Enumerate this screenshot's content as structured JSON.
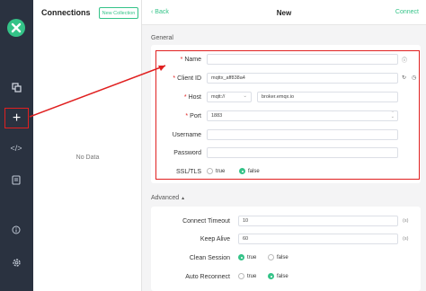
{
  "sidebar": {
    "logo": "mqttx-logo",
    "icons": [
      "connections-icon",
      "add-icon",
      "script-icon",
      "log-icon",
      "info-icon",
      "gear-icon"
    ]
  },
  "connections": {
    "title": "Connections",
    "new_collection": "New Collection",
    "empty": "No Data"
  },
  "header": {
    "back": "Back",
    "title": "New",
    "connect": "Connect"
  },
  "general": {
    "title": "General",
    "name_label": "Name",
    "name_value": "",
    "client_id_label": "Client ID",
    "client_id_value": "mqttx_aff838a4",
    "host_label": "Host",
    "protocol": "mqtt://",
    "host_value": "broker.emqx.io",
    "port_label": "Port",
    "port_value": "1883",
    "username_label": "Username",
    "password_label": "Password",
    "ssl_label": "SSL/TLS",
    "ssl_true": "true",
    "ssl_false": "false",
    "ssl_selected": "false"
  },
  "advanced": {
    "title": "Advanced",
    "connect_timeout_label": "Connect Timeout",
    "connect_timeout_value": "10",
    "connect_timeout_unit": "(s)",
    "keep_alive_label": "Keep Alive",
    "keep_alive_value": "60",
    "keep_alive_unit": "(s)",
    "clean_session_label": "Clean Session",
    "clean_session_selected": "true",
    "auto_reconnect_label": "Auto Reconnect",
    "auto_reconnect_selected": "false",
    "true_label": "true",
    "false_label": "false"
  },
  "colors": {
    "accent": "#34c388",
    "sidebar": "#2a3240",
    "highlight": "#e02020"
  }
}
